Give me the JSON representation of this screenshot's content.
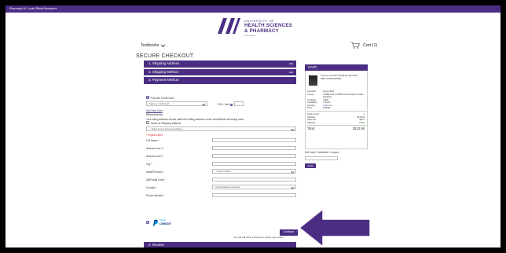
{
  "topbar": {
    "text": "Pharmacy-St. Louis Official Bookstore"
  },
  "logo": {
    "line1": "UNIVERSITY OF",
    "line2": "HEALTH SCIENCES",
    "line3": "& PHARMACY",
    "line4": "in St. Louis"
  },
  "nav": {
    "textbooks": "Textbooks",
    "cart": "Cart (1)"
  },
  "checkout": {
    "title": "SECURE CHECKOUT",
    "steps": [
      {
        "label": "1. Shipping Address",
        "edit": "Edit"
      },
      {
        "label": "2. Shipping Method",
        "edit": "Edit"
      },
      {
        "label": "3. Payment Method"
      },
      {
        "label": "4. Review"
      }
    ]
  },
  "payment": {
    "pay_with_credit_card": "Pay with Credit Card",
    "select_credit_card": "Select a Credit Card",
    "cvv_code": "CVV Code",
    "add_new_card": "Add New Card",
    "billing_address": "Billing Address",
    "billing_note": "Your billing address should match the billing address on the credit/debit card being used.",
    "same_as_shipping": "Same as Shipping Address",
    "previous_address": "-- Select to Use Previous Address --",
    "required_field": "* required field",
    "full_name": "Full Name",
    "address1": "Address Line 1",
    "address2": "Address Line 2",
    "city": "City",
    "state": "State/Province",
    "state_placeholder": "--Select a State--",
    "zip": "Zip/Postal Code",
    "country": "Country",
    "country_value": "United States of America",
    "phone": "Phone Number",
    "paypal_line1": "PayPal",
    "paypal_line2": "CREDIT"
  },
  "actions": {
    "continue": "Continue",
    "continue_note": "You will still have a chance to review your order."
  },
  "cart": {
    "title": "CART",
    "book_title": "The Art of Public Speaking (Revised)",
    "isbn": "ISBN: 9780073523910",
    "semester_label": "Semester:",
    "semester": "Spring 2023",
    "course_label": "Course:",
    "course": "COMM-1130-1 FB00 Fundamentals in Public Speaking",
    "condition_label": "Condition:",
    "condition": "USED",
    "availability_label": "Availability:",
    "availability": "In Stock",
    "quantity_label": "Quantity:",
    "quantity": "1 Remove",
    "price_label": "Price:",
    "price": "$108.96",
    "items_label": "Items in Cart:",
    "items_count": "1",
    "subtotal_label": "Subtotal:",
    "subtotal": "$108.96",
    "tax_label": "Sales Tax:",
    "tax": "$9.13",
    "shipping_label": "Shipping:",
    "shipping": "FREE",
    "total_label": "Total:",
    "total": "$110.86"
  },
  "gift": {
    "label": "Gift Card / Certificate / Coupon",
    "apply": "Apply"
  },
  "colors": {
    "brand": "#4b2e83",
    "free": "#2a8a2a",
    "required": "#dd2222"
  }
}
